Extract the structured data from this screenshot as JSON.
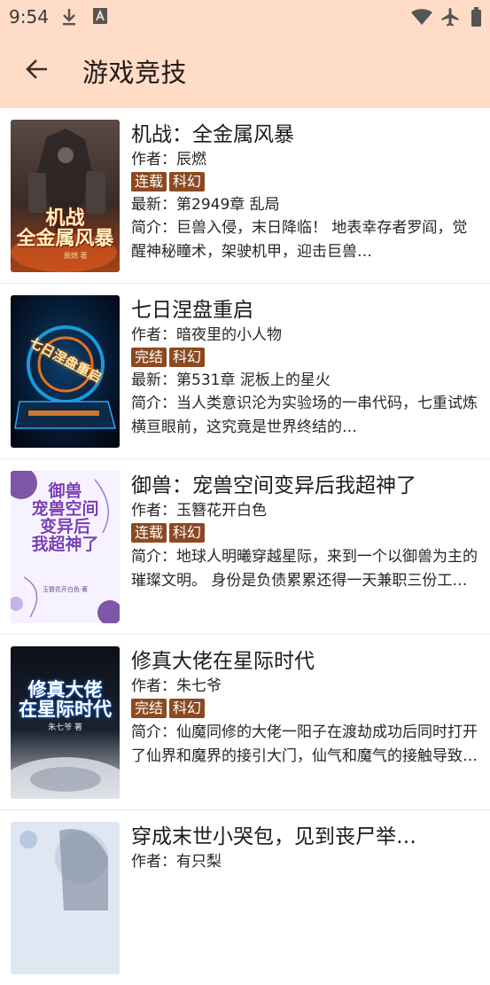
{
  "status_bar": {
    "time": "9:54",
    "icons": [
      "download-icon",
      "text-a-icon",
      "wifi-icon",
      "airplane-icon",
      "battery-icon"
    ]
  },
  "header": {
    "title": "游戏竞技",
    "back_icon": "arrow-left-icon"
  },
  "colors": {
    "header_bg": "#ffdcc8",
    "tag_bg": "#8b4a22",
    "tag_text": "#ffffff"
  },
  "books": [
    {
      "title": "机战：全金属风暴",
      "author": "作者：辰燃",
      "status_tag": "连载",
      "genre_tag": "科幻",
      "latest": "最新：第2949章 乱局",
      "intro": "简介：巨兽入侵，末日降临！ 地表幸存者罗阎，觉醒神秘瞳术，架驶机甲，迎击巨兽…",
      "cover_text": "机战\n全金属风暴",
      "cover_subtext": "辰燃 著"
    },
    {
      "title": "七日涅盘重启",
      "author": "作者：暗夜里的小人物",
      "status_tag": "完结",
      "genre_tag": "科幻",
      "latest": "最新：第531章 泥板上的星火",
      "intro": "简介：当人类意识沦为实验场的一串代码，七重试炼横亘眼前，这究竟是世界终结的…",
      "cover_text": "七日涅盘重启",
      "cover_subtext": ""
    },
    {
      "title": "御兽：宠兽空间变异后我超神了",
      "author": "作者：玉簪花开白色",
      "status_tag": "连载",
      "genre_tag": "科幻",
      "latest": "",
      "intro": "简介：地球人明曦穿越星际，来到一个以御兽为主的璀璨文明。 身份是负债累累还得一天兼职三份工养家的苦逼初中女生。 人干…",
      "cover_text": "御兽\n宠兽空间\n变异后\n我超神了",
      "cover_subtext": "玉簪花开白色·著"
    },
    {
      "title": "修真大佬在星际时代",
      "author": "作者：朱七爷",
      "status_tag": "完结",
      "genre_tag": "科幻",
      "latest": "",
      "intro": "简介：仙魔同修的大佬一阳子在渡劫成功后同时打开了仙界和魔界的接引大门，仙气和魔气的接触导致了剧烈的爆炸，一阳子在…",
      "cover_text": "修真大佬\n在星际时代",
      "cover_subtext": "朱七爷 著"
    },
    {
      "title": "穿成末世小哭包，见到丧尸举…",
      "author": "作者：有只梨",
      "status_tag": "",
      "genre_tag": "",
      "latest": "",
      "intro": "",
      "cover_text": "",
      "cover_subtext": ""
    }
  ]
}
